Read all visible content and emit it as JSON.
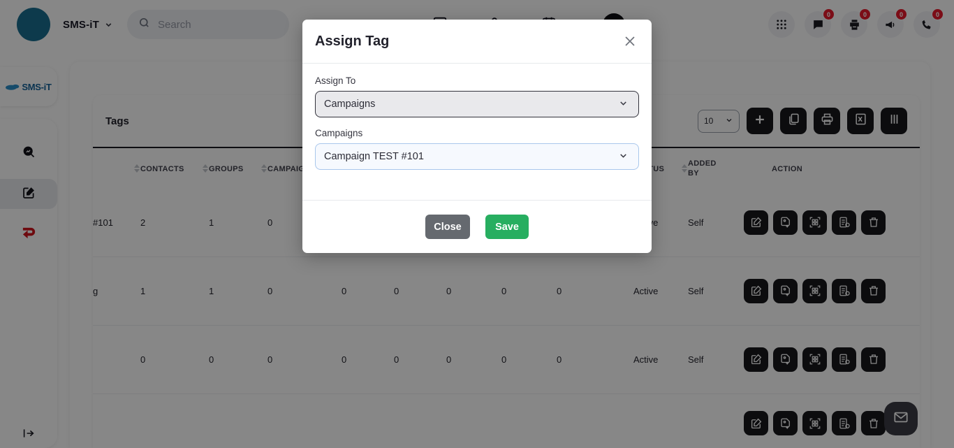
{
  "navbar": {
    "brand": "SMS-iT",
    "brand_chevron_icon": "chevron-down-icon",
    "search_placeholder": "Search",
    "search_icon": "search-icon",
    "avatar_color": "#1a6f90",
    "add_button_icon": "plus-icon",
    "right_icons": [
      {
        "icon": "apps-grid-icon",
        "badge": ""
      },
      {
        "icon": "chat-bubble-icon",
        "badge": "0"
      },
      {
        "icon": "printer-icon",
        "badge": "0"
      },
      {
        "icon": "megaphone-icon",
        "badge": "0"
      },
      {
        "icon": "phone-icon",
        "badge": "0"
      }
    ],
    "badge_color": "#e8192c"
  },
  "sidebar": {
    "logo_text": "SMS-iT",
    "items": [
      {
        "icon": "analytics-search-icon",
        "active": false
      },
      {
        "icon": "edit-square-icon",
        "active": true
      },
      {
        "icon": "return-arrow-icon",
        "active": false
      }
    ],
    "collapse_icon": "expand-right-icon"
  },
  "panel": {
    "title": "Tags",
    "page_length": "10",
    "page_length_chevron": "chevron-down-icon",
    "tools": [
      {
        "icon": "plus-icon",
        "name": "add-tag-button"
      },
      {
        "icon": "copy-icon",
        "name": "copy-button"
      },
      {
        "icon": "printer-icon",
        "name": "print-button"
      },
      {
        "icon": "excel-icon",
        "name": "excel-export-button"
      },
      {
        "icon": "columns-icon",
        "name": "column-visibility-button"
      }
    ]
  },
  "table": {
    "columns": [
      {
        "label": "",
        "sortable": false
      },
      {
        "label": "CONTACTS",
        "sortable": true
      },
      {
        "label": "GROUPS",
        "sortable": true
      },
      {
        "label": "CAMPAIGNS",
        "sortable": true
      },
      {
        "label": "",
        "sortable": true
      },
      {
        "label": "",
        "sortable": true
      },
      {
        "label": "",
        "sortable": true
      },
      {
        "label": "",
        "sortable": true
      },
      {
        "label": "",
        "sortable": true
      },
      {
        "label": "STATUS",
        "sortable": true
      },
      {
        "label": "ADDED BY",
        "sortable": true
      },
      {
        "label": "ACTION",
        "sortable": false
      }
    ],
    "rows": [
      {
        "name": "#101",
        "contacts": "2",
        "groups": "1",
        "campaigns": "0",
        "c4": "",
        "c5": "",
        "c6": "",
        "c7": "",
        "c8": "",
        "status": "Active",
        "added_by": "Self"
      },
      {
        "name": "g",
        "contacts": "1",
        "groups": "1",
        "campaigns": "0",
        "c4": "0",
        "c5": "0",
        "c6": "0",
        "c7": "0",
        "c8": "0",
        "status": "Active",
        "added_by": "Self"
      },
      {
        "name": "",
        "contacts": "0",
        "groups": "0",
        "campaigns": "0",
        "c4": "0",
        "c5": "0",
        "c6": "0",
        "c7": "0",
        "c8": "0",
        "status": "Active",
        "added_by": "Self"
      }
    ],
    "row_actions": [
      {
        "icon": "edit-icon"
      },
      {
        "icon": "tag-add-icon"
      },
      {
        "icon": "qr-code-icon"
      },
      {
        "icon": "report-list-icon"
      },
      {
        "icon": "trash-icon"
      }
    ]
  },
  "fab": {
    "icon": "envelope-icon"
  },
  "modal": {
    "title": "Assign Tag",
    "close_icon": "close-icon",
    "assign_to_label": "Assign To",
    "assign_to_value": "Campaigns",
    "assign_to_chevron": "chevron-down-icon",
    "campaigns_label": "Campaigns",
    "campaigns_value": "Campaign TEST #101",
    "campaigns_chevron": "chevron-down-icon",
    "close_button": "Close",
    "save_button": "Save",
    "save_color": "#27ae60",
    "close_color": "#65696f"
  }
}
